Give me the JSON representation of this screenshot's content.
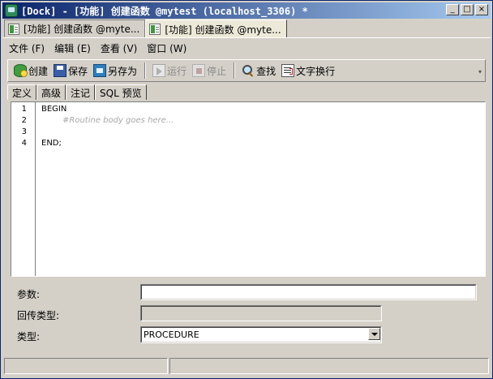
{
  "window": {
    "title": "[Dock] - [功能] 创建函数 @mytest (localhost_3306) *",
    "controls": {
      "minimize": "_",
      "maximize": "□",
      "close": "×"
    }
  },
  "doc_tabs": [
    {
      "label": "[功能] 创建函数 @myte...",
      "icon": "function-doc-icon"
    },
    {
      "label": "[功能] 创建函数 @myte...",
      "icon": "function-doc-icon"
    }
  ],
  "menu": [
    {
      "label": "文件 (F)"
    },
    {
      "label": "编辑 (E)"
    },
    {
      "label": "查看 (V)"
    },
    {
      "label": "窗口 (W)"
    }
  ],
  "toolbar": {
    "create": "创建",
    "save": "保存",
    "save_as": "另存为",
    "run": "运行",
    "stop": "停止",
    "find": "查找",
    "wrap": "文字换行"
  },
  "subtabs": [
    {
      "label": "定义"
    },
    {
      "label": "高级"
    },
    {
      "label": "注记"
    },
    {
      "label": "SQL 预览"
    }
  ],
  "editor": {
    "lines": [
      {
        "num": "1",
        "text": "BEGIN"
      },
      {
        "num": "2",
        "text": "#Routine body goes here..."
      },
      {
        "num": "3",
        "text": ""
      },
      {
        "num": "4",
        "text": "END;"
      }
    ]
  },
  "form": {
    "params_label": "参数:",
    "params_value": "",
    "return_type_label": "回传类型:",
    "return_type_value": "",
    "type_label": "类型:",
    "type_value": "PROCEDURE"
  }
}
